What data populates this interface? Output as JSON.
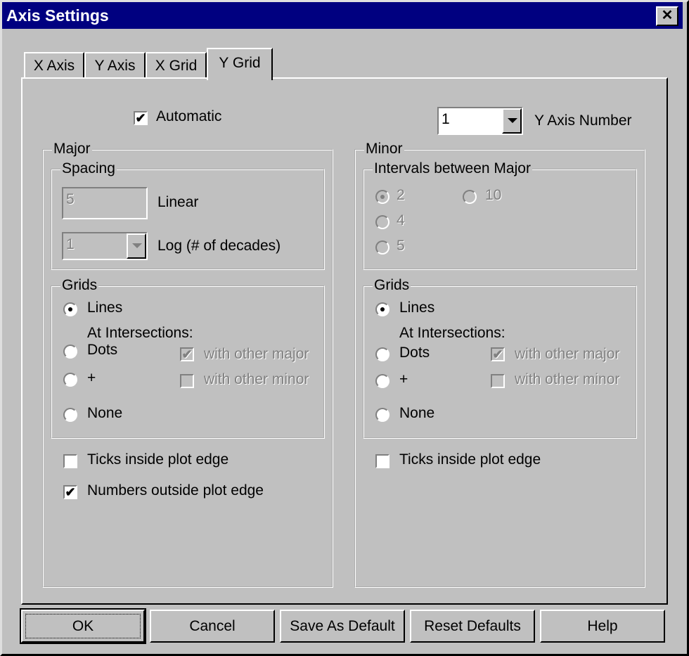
{
  "window": {
    "title": "Axis Settings",
    "close_glyph": "✕"
  },
  "tabs": [
    {
      "label": "X Axis"
    },
    {
      "label": "Y Axis"
    },
    {
      "label": "X Grid"
    },
    {
      "label": "Y Grid",
      "active": true
    }
  ],
  "top": {
    "automatic_label": "Automatic",
    "automatic_checked": true,
    "y_axis_number_value": "1",
    "y_axis_number_label": "Y Axis Number"
  },
  "major": {
    "title": "Major",
    "spacing": {
      "title": "Spacing",
      "linear_value": "5",
      "linear_label": "Linear",
      "log_value": "1",
      "log_label": "Log (# of decades)"
    },
    "grids": {
      "title": "Grids",
      "lines_label": "Lines",
      "at_intersections_label": "At Intersections:",
      "dots_label": "Dots",
      "plus_label": "+",
      "none_label": "None",
      "with_other_major_label": "with other major",
      "with_other_minor_label": "with other minor",
      "selected": "Lines"
    },
    "ticks_inside_label": "Ticks inside plot edge",
    "ticks_inside_checked": false,
    "numbers_outside_label": "Numbers outside plot edge",
    "numbers_outside_checked": true
  },
  "minor": {
    "title": "Minor",
    "intervals": {
      "title": "Intervals between Major",
      "opt_2": "2",
      "opt_4": "4",
      "opt_5": "5",
      "opt_10": "10",
      "selected": "2"
    },
    "grids": {
      "title": "Grids",
      "lines_label": "Lines",
      "at_intersections_label": "At Intersections:",
      "dots_label": "Dots",
      "plus_label": "+",
      "none_label": "None",
      "with_other_major_label": "with other major",
      "with_other_minor_label": "with other minor",
      "selected": "Lines"
    },
    "ticks_inside_label": "Ticks inside plot edge",
    "ticks_inside_checked": false
  },
  "buttons": {
    "ok": "OK",
    "cancel": "Cancel",
    "save_default": "Save As Default",
    "reset_defaults": "Reset Defaults",
    "help": "Help"
  }
}
